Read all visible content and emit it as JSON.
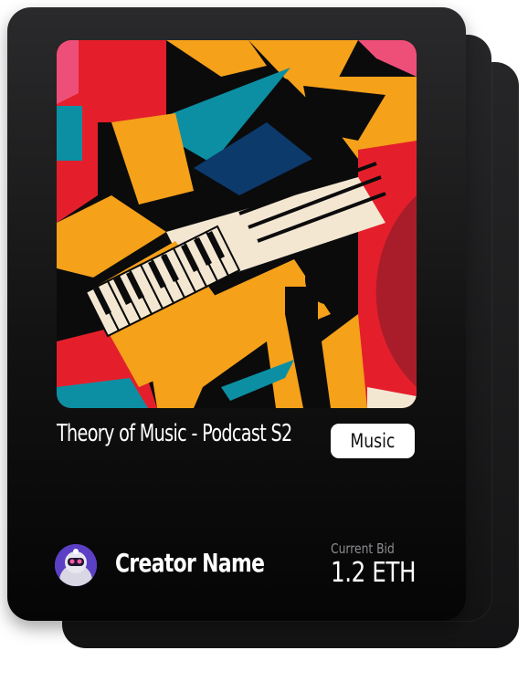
{
  "card": {
    "title": "Theory of Music - Podcast S2",
    "tag": "Music",
    "creator_name": "Creator Name",
    "bid_label": "Current Bid",
    "bid_value": "1.2 ETH"
  },
  "artwork": {
    "icon": "abstract-piano-artwork",
    "palette": [
      "#e41f2b",
      "#f5a11a",
      "#0b0b0c",
      "#0c8fa3",
      "#f3e7d2",
      "#a91d2a",
      "#ee4f78"
    ]
  },
  "avatar": {
    "icon": "astronaut-avatar"
  }
}
